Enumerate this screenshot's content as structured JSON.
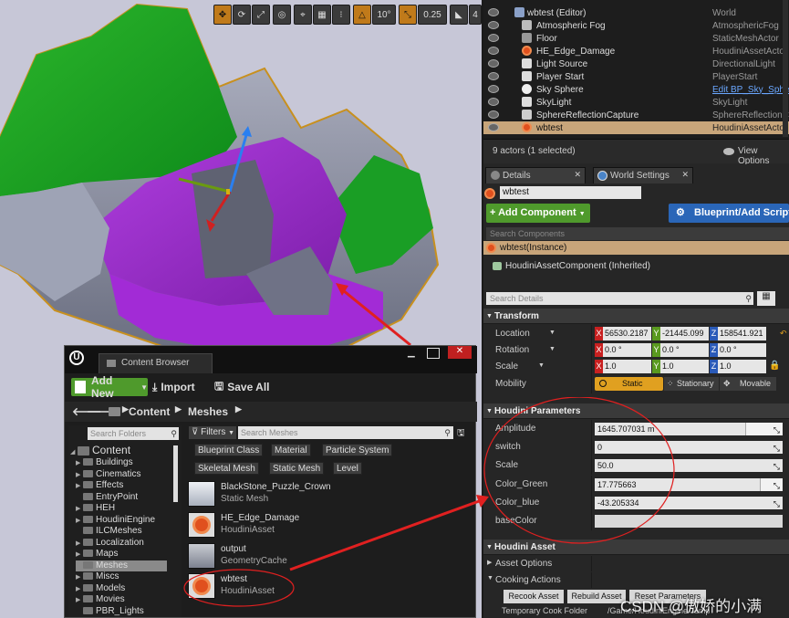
{
  "viewport": {
    "toolbar": {
      "rotate_snap_value": "10°",
      "scale_snap_value": "0.25",
      "camera_speed_value": "4"
    }
  },
  "outliner": {
    "rows": [
      {
        "label": "wbtest (Editor)",
        "type": "World",
        "icon": "world-icon",
        "depth": 0
      },
      {
        "label": "Atmospheric Fog",
        "type": "AtmosphericFog",
        "icon": "fog-icon",
        "depth": 1
      },
      {
        "label": "Floor",
        "type": "StaticMeshActor",
        "icon": "mesh-icon",
        "depth": 1
      },
      {
        "label": "HE_Edge_Damage",
        "type": "HoudiniAssetActor",
        "icon": "houdini-icon",
        "depth": 1
      },
      {
        "label": "Light Source",
        "type": "DirectionalLight",
        "icon": "light-icon",
        "depth": 1
      },
      {
        "label": "Player Start",
        "type": "PlayerStart",
        "icon": "player-start-icon",
        "depth": 1
      },
      {
        "label": "Sky Sphere",
        "type": "Edit BP_Sky_Sphere",
        "icon": "sphere-icon",
        "depth": 1,
        "link": true
      },
      {
        "label": "SkyLight",
        "type": "SkyLight",
        "icon": "skylight-icon",
        "depth": 1
      },
      {
        "label": "SphereReflectionCapture",
        "type": "SphereReflectionCapture",
        "icon": "reflection-icon",
        "depth": 1
      },
      {
        "label": "wbtest",
        "type": "HoudiniAssetActor",
        "icon": "houdini-icon",
        "depth": 1,
        "selected": true
      }
    ],
    "footer_count": "9 actors (1 selected)",
    "view_options": "View Options"
  },
  "details": {
    "tabs": [
      "Details",
      "World Settings"
    ],
    "actor_name": "wbtest",
    "add_component": "+ Add Component",
    "blueprint_button": "Blueprint/Add Script",
    "search_components_placeholder": "Search Components",
    "instance_label": "wbtest(Instance)",
    "inherited_component": "HoudiniAssetComponent (Inherited)",
    "search_details_placeholder": "Search Details",
    "transform": {
      "title": "Transform",
      "location_label": "Location",
      "rotation_label": "Rotation",
      "scale_label": "Scale",
      "mobility_label": "Mobility",
      "location": [
        "56530.2187",
        "-21445.099",
        "158541.921"
      ],
      "rotation": [
        "0.0 °",
        "0.0 °",
        "0.0 °"
      ],
      "scale": [
        "1.0",
        "1.0",
        "1.0"
      ],
      "mobility_options": [
        "Static",
        "Stationary",
        "Movable"
      ]
    },
    "houdini_params": {
      "title": "Houdini Parameters",
      "rows": [
        {
          "label": "Amplitude",
          "value": "1645.707031 m"
        },
        {
          "label": "switch",
          "value": "0"
        },
        {
          "label": "Scale",
          "value": "50.0"
        },
        {
          "label": "Color_Green",
          "value": "17.775663"
        },
        {
          "label": "Color_blue",
          "value": "-43.205334"
        },
        {
          "label": "baseColor",
          "value": ""
        }
      ]
    },
    "houdini_asset": {
      "title": "Houdini Asset",
      "asset_options": "Asset Options",
      "cooking_actions": "Cooking Actions",
      "recook": "Recook Asset",
      "rebuild": "Rebuild Asset",
      "reset": "Reset Parameters",
      "temp_folder_label": "Temporary Cook Folder",
      "temp_folder_value": "/Game/HoudiniEngine/Temp"
    }
  },
  "content_browser": {
    "title": "Content Browser",
    "add_new": "Add New",
    "import": "Import",
    "save_all": "Save All",
    "breadcrumb": [
      "Content",
      "Meshes"
    ],
    "search_folders_placeholder": "Search Folders",
    "filters": "Filters",
    "search_meshes_placeholder": "Search Meshes",
    "filter_chips": [
      "Blueprint Class",
      "Material",
      "Particle System",
      "Skeletal Mesh",
      "Static Mesh",
      "Level"
    ],
    "tree": [
      {
        "label": "Content",
        "root": true
      },
      {
        "label": "Buildings"
      },
      {
        "label": "Cinematics"
      },
      {
        "label": "Effects"
      },
      {
        "label": "EntryPoint"
      },
      {
        "label": "HEH"
      },
      {
        "label": "HoudiniEngine"
      },
      {
        "label": "ILCMeshes"
      },
      {
        "label": "Localization"
      },
      {
        "label": "Maps"
      },
      {
        "label": "Meshes",
        "selected": true
      },
      {
        "label": "Miscs"
      },
      {
        "label": "Models"
      },
      {
        "label": "Movies"
      },
      {
        "label": "PBR_Lights"
      }
    ],
    "assets": [
      {
        "name": "BlackStone_Puzzle_Crown",
        "type": "Static Mesh"
      },
      {
        "name": "HE_Edge_Damage",
        "type": "HoudiniAsset"
      },
      {
        "name": "output",
        "type": "GeometryCache"
      },
      {
        "name": "wbtest",
        "type": "HoudiniAsset"
      }
    ]
  },
  "watermark": "CSDN @傲娇的小满",
  "colors": {
    "accent_orange": "#c8a57a",
    "add_green": "#5aa93a",
    "blueprint_blue": "#2a66b8",
    "annotation_red": "#e02020"
  }
}
